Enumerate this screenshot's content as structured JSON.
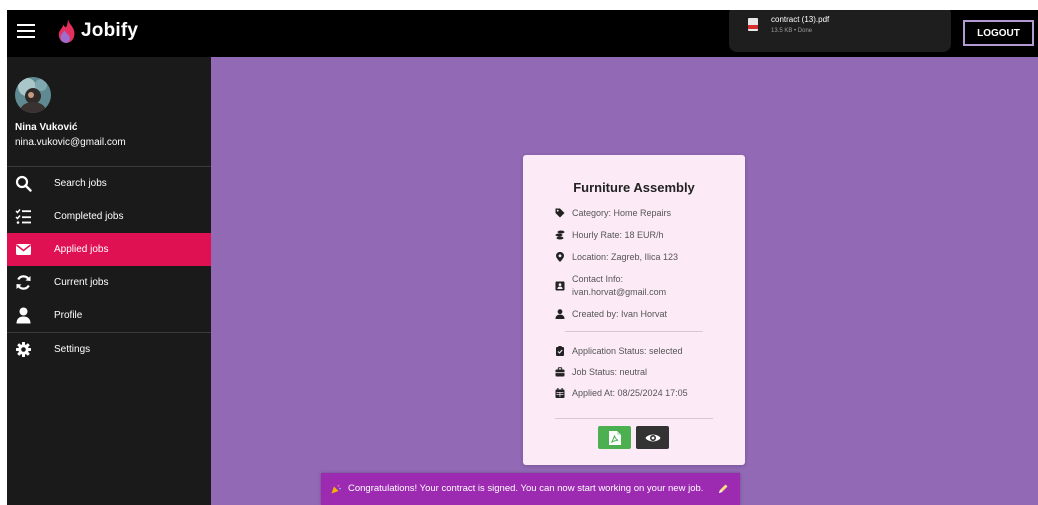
{
  "app": {
    "name": "Jobify"
  },
  "download": {
    "file_name": "contract (13).pdf",
    "meta": "13.5 KB • Done"
  },
  "header": {
    "logout_label": "LOGOUT"
  },
  "user": {
    "name": "Nina Vuković",
    "email": "nina.vukovic@gmail.com"
  },
  "sidebar": {
    "items": [
      {
        "label": "Search jobs",
        "icon": "search-icon",
        "active": false
      },
      {
        "label": "Completed jobs",
        "icon": "checklist-icon",
        "active": false
      },
      {
        "label": "Applied jobs",
        "icon": "envelope-icon",
        "active": true
      },
      {
        "label": "Current jobs",
        "icon": "sync-icon",
        "active": false
      },
      {
        "label": "Profile",
        "icon": "user-icon",
        "active": false
      },
      {
        "label": "Settings",
        "icon": "gear-icon",
        "active": false
      }
    ]
  },
  "job": {
    "title": "Furniture Assembly",
    "category": "Category: Home Repairs",
    "hourly_rate": "Hourly Rate: 18 EUR/h",
    "location": "Location: Zagreb, Ilica 123",
    "contact_label": "Contact Info:",
    "contact_email": "ivan.horvat@gmail.com",
    "created_by": "Created by: Ivan Horvat",
    "application_status": "Application Status: selected",
    "job_status": "Job Status: neutral",
    "applied_at": "Applied At: 08/25/2024 17:05"
  },
  "toast": {
    "message": "Congratulations! Your contract is signed. You can now start working on your new job."
  },
  "colors": {
    "background": "#9169b5",
    "topbar": "#000000",
    "sidebar": "#1a1a1a",
    "active_item": "#e01153",
    "card": "#fcebf7",
    "toast": "#9c2bb2",
    "pdf_button": "#4caf50",
    "view_button": "#333333"
  }
}
